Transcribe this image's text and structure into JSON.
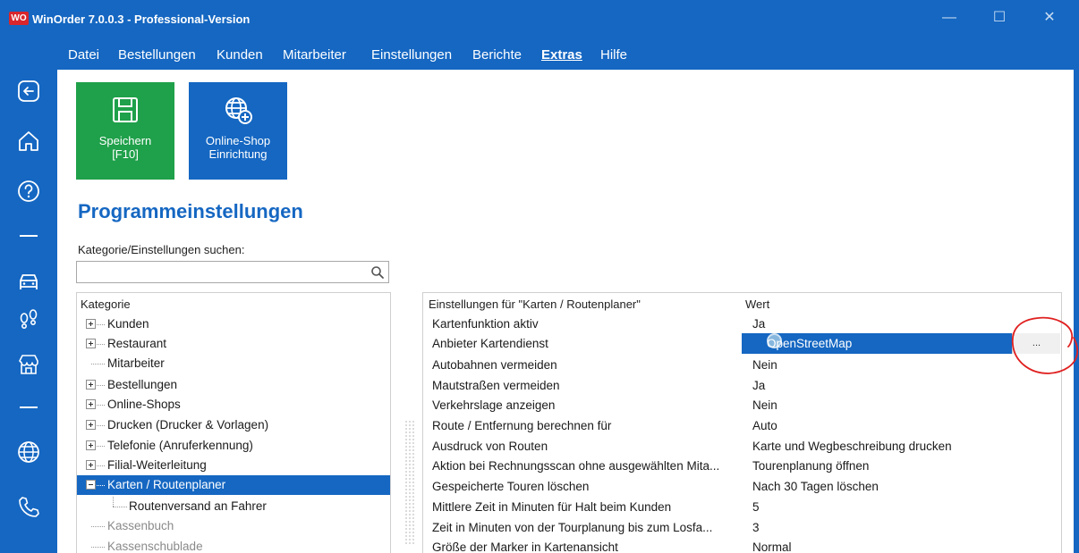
{
  "window": {
    "logo_text": "WO",
    "title": "WinOrder 7.0.0.3 - Professional-Version",
    "controls": [
      "—",
      "☐",
      "✕"
    ]
  },
  "menu": {
    "items": [
      {
        "label": "Datei"
      },
      {
        "label": "Bestellungen"
      },
      {
        "label": "Kunden"
      },
      {
        "label": "Mitarbeiter"
      },
      {
        "label": "Einstellungen"
      },
      {
        "label": "Berichte"
      },
      {
        "label": "Extras",
        "active": true
      },
      {
        "label": "Hilfe"
      }
    ]
  },
  "sidebar": {
    "icons": [
      "back-icon",
      "home-icon",
      "help-icon",
      "car-icon",
      "footsteps-icon",
      "store-icon",
      "globe-icon",
      "phone-icon"
    ]
  },
  "ribbon": {
    "save": {
      "line1": "Speichern",
      "line2": "[F10]",
      "color": "#1fa04a"
    },
    "shop": {
      "line1": "Online-Shop",
      "line2": "Einrichtung",
      "color": "#1567c2"
    }
  },
  "page": {
    "title": "Programmeinstellungen",
    "search_label": "Kategorie/Einstellungen suchen:",
    "search_value": ""
  },
  "categories": {
    "header": "Kategorie",
    "items": [
      {
        "label": "Kunden",
        "expander": "plus"
      },
      {
        "label": "Restaurant",
        "expander": "plus"
      },
      {
        "label": "Mitarbeiter",
        "expander": "none"
      },
      {
        "label": "Bestellungen",
        "expander": "plus"
      },
      {
        "label": "Online-Shops",
        "expander": "plus"
      },
      {
        "label": "Drucken (Drucker & Vorlagen)",
        "expander": "plus"
      },
      {
        "label": "Telefonie (Anruferkennung)",
        "expander": "plus"
      },
      {
        "label": "Filial-Weiterleitung",
        "expander": "plus"
      },
      {
        "label": "Karten / Routenplaner",
        "expander": "minus",
        "selected": true
      },
      {
        "label": "Routenversand an Fahrer",
        "expander": "child"
      },
      {
        "label": "Kassenbuch",
        "expander": "none",
        "dim": true
      },
      {
        "label": "Kassenschublade",
        "expander": "none",
        "dim": true
      }
    ]
  },
  "settings": {
    "header_name": "Einstellungen für \"Karten / Routenplaner\"",
    "header_value": "Wert",
    "ellipsis_label": "...",
    "rows": [
      {
        "name": "Kartenfunktion aktiv",
        "value": "Ja"
      },
      {
        "name": "Anbieter Kartendienst",
        "value": "OpenStreetMap",
        "selected": true
      },
      {
        "name": "Autobahnen vermeiden",
        "value": "Nein"
      },
      {
        "name": "Mautstraßen vermeiden",
        "value": "Ja"
      },
      {
        "name": "Verkehrslage anzeigen",
        "value": "Nein"
      },
      {
        "name": "Route / Entfernung berechnen für",
        "value": "Auto"
      },
      {
        "name": "Ausdruck von Routen",
        "value": "Karte und Wegbeschreibung drucken"
      },
      {
        "name": "Aktion bei Rechnungsscan ohne ausgewählten Mita...",
        "value": "Tourenplanung öffnen"
      },
      {
        "name": "Gespeicherte Touren löschen",
        "value": "Nach 30 Tagen löschen"
      },
      {
        "name": "Mittlere Zeit in Minuten für Halt beim Kunden",
        "value": "5"
      },
      {
        "name": "Zeit in Minuten von der Tourplanung bis zum Losfa...",
        "value": "3"
      },
      {
        "name": "Größe der Marker in Kartenansicht",
        "value": "Normal"
      }
    ]
  },
  "colors": {
    "accent": "#1567c2",
    "save_green": "#1fa04a",
    "annotation_red": "#e02020"
  }
}
